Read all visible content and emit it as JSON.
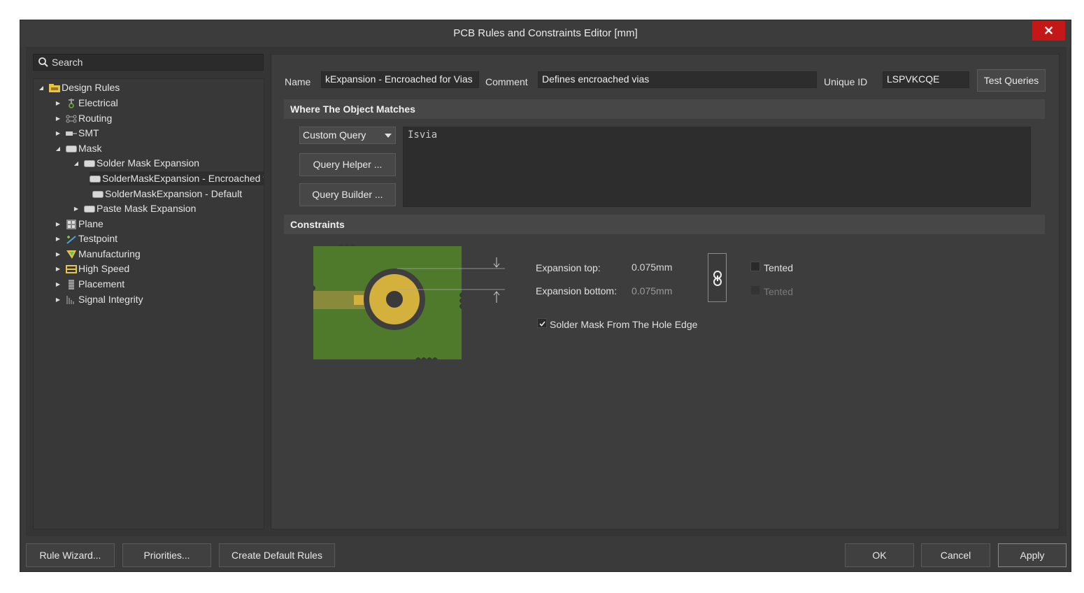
{
  "window": {
    "title": "PCB Rules and Constraints Editor [mm]",
    "close_glyph": "✕"
  },
  "search": {
    "placeholder": "Search"
  },
  "tree": {
    "design_rules": "Design Rules",
    "electrical": "Electrical",
    "routing": "Routing",
    "smt": "SMT",
    "mask": "Mask",
    "solder_mask_expansion": "Solder Mask Expansion",
    "rule_encroached": "SolderMaskExpansion - Encroached for Vias",
    "rule_default": "SolderMaskExpansion - Default",
    "paste_mask_expansion": "Paste Mask Expansion",
    "plane": "Plane",
    "testpoint": "Testpoint",
    "manufacturing": "Manufacturing",
    "high_speed": "High Speed",
    "placement": "Placement",
    "signal_integrity": "Signal Integrity"
  },
  "rule": {
    "name_label": "Name",
    "name_value": "kExpansion - Encroached for Vias",
    "comment_label": "Comment",
    "comment_value": "Defines encroached vias",
    "uid_label": "Unique ID",
    "uid_value": "LSPVKCQE",
    "test_queries": "Test Queries"
  },
  "match": {
    "header": "Where The Object Matches",
    "dropdown_value": "Custom Query",
    "query_helper": "Query Helper ...",
    "query_builder": "Query Builder ...",
    "query_text": "Isvia"
  },
  "constraints": {
    "header": "Constraints",
    "expansion_top_label": "Expansion top:",
    "expansion_top_value": "0.075mm",
    "expansion_bottom_label": "Expansion bottom:",
    "expansion_bottom_value": "0.075mm",
    "tented_top": "Tented",
    "tented_bottom": "Tented",
    "hole_edge_label": "Solder Mask From The Hole Edge",
    "hole_edge_checked": true
  },
  "footer": {
    "rule_wizard": "Rule Wizard...",
    "priorities": "Priorities...",
    "create_default": "Create Default Rules",
    "ok": "OK",
    "cancel": "Cancel",
    "apply": "Apply"
  },
  "colors": {
    "board_green": "#4f7a2c",
    "pad_gold": "#d4b13c",
    "close_red": "#c41818"
  }
}
